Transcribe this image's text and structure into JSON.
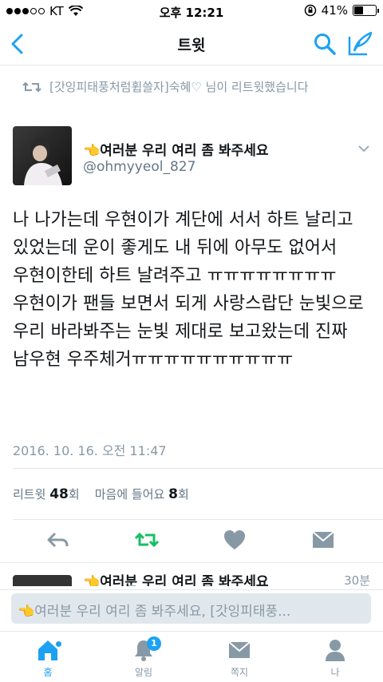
{
  "status_bar": {
    "carrier": "KT",
    "time": "오후 12:21",
    "battery_text": "41%",
    "battery_level": 0.41
  },
  "nav": {
    "title": "트윗"
  },
  "retweet_context": {
    "text": "[갓잉피태풍처럼휩쓸자]숙혜♡ 님이 리트윗했습니다"
  },
  "author": {
    "name": "👈여러분 우리 여리 좀 봐주세요",
    "handle": "@ohmyyeol_827"
  },
  "tweet": {
    "text": "나 나가는데 우현이가 계단에 서서 하트 날리고 있었는데 운이 좋게도 내 뒤에 아무도 없어서 우현이한테 하트 날려주고 ㅠㅠㅠㅠㅠㅠㅠㅠ 우현이가 팬들 보면서 되게 사랑스랍단 눈빛으로 우리 바라봐주는 눈빛 제대로 보고왔는데 진짜 남우현 우주체거ㅠㅠㅠㅠㅠㅠㅠㅠㅠㅠ",
    "timestamp": "2016. 10. 16. 오전 11:47"
  },
  "stats": {
    "retweet_label": "리트윗",
    "retweet_count": "48",
    "retweet_unit": "회",
    "like_label": "마음에 들어요",
    "like_count": "8",
    "like_unit": "회"
  },
  "peek": {
    "text": "👈여러분 우리 여리 좀 봐주세요",
    "time": "30분"
  },
  "reply": {
    "placeholder": "👈여러분 우리 여리 좀 봐주세요, [갓잉피태풍..."
  },
  "tabs": [
    {
      "label": "홈",
      "icon": "home-icon"
    },
    {
      "label": "알림",
      "icon": "bell-icon",
      "badge": "1"
    },
    {
      "label": "쪽지",
      "icon": "envelope-icon"
    },
    {
      "label": "나",
      "icon": "person-icon"
    }
  ],
  "colors": {
    "accent": "#1da1f2",
    "retweet_green": "#17bf63",
    "muted": "#8899a6"
  }
}
